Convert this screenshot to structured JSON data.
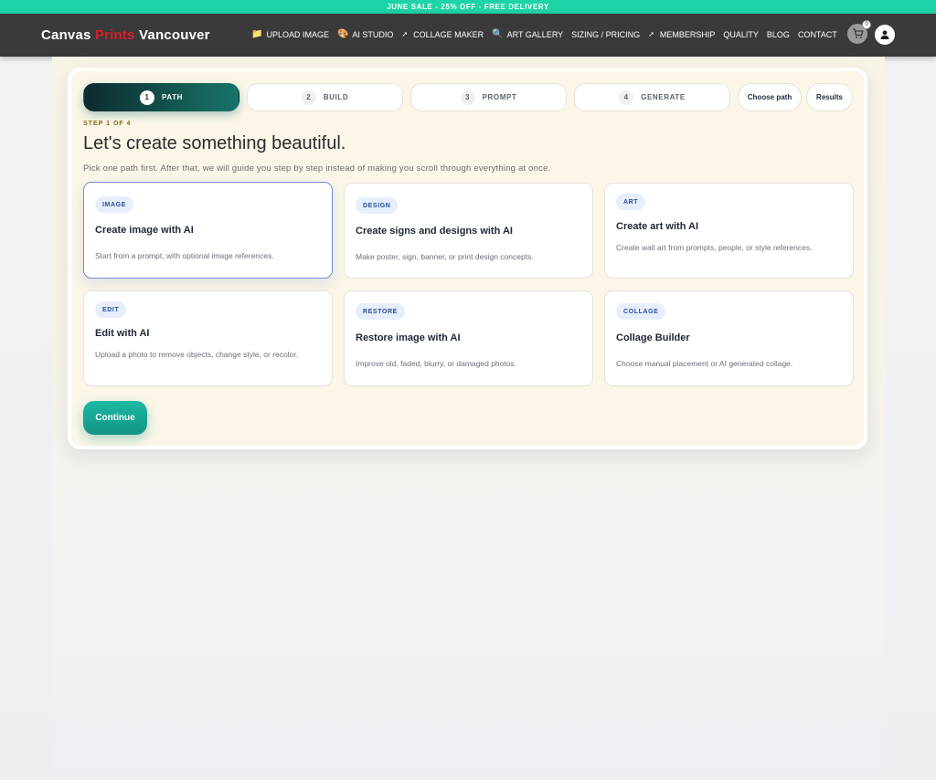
{
  "promo": {
    "text": "JUNE SALE - 25% OFF - FREE DELIVERY"
  },
  "header": {
    "logo": {
      "part1": "Canvas ",
      "part2": "Prints",
      "part3": " Vancouver"
    },
    "nav": [
      {
        "label": "UPLOAD IMAGE",
        "icon": "folder-icon"
      },
      {
        "label": "AI STUDIO",
        "icon": "palette-icon"
      },
      {
        "label": "COLLAGE MAKER",
        "icon": "arrow-icon"
      },
      {
        "label": "ART GALLERY",
        "icon": "magnifier-icon"
      },
      {
        "label": "SIZING / PRICING",
        "icon": ""
      },
      {
        "label": "MEMBERSHIP",
        "icon": "arrow-icon"
      },
      {
        "label": "QUALITY",
        "icon": ""
      },
      {
        "label": "BLOG",
        "icon": ""
      },
      {
        "label": "CONTACT",
        "icon": ""
      }
    ],
    "cart_count": "0"
  },
  "wizard": {
    "steps": [
      {
        "num": "1",
        "label": "PATH",
        "active": true
      },
      {
        "num": "2",
        "label": "BUILD",
        "active": false
      },
      {
        "num": "3",
        "label": "PROMPT",
        "active": false
      },
      {
        "num": "4",
        "label": "GENERATE",
        "active": false
      }
    ],
    "choose_path": "Choose path",
    "results": "Results",
    "step_label": "STEP 1 OF 4",
    "title": "Let's create something beautiful.",
    "subtitle": "Pick one path first. After that, we will guide you step by step instead of making you scroll through everything at once.",
    "cards": [
      {
        "badge": "IMAGE",
        "title": "Create image with AI",
        "desc": "Start from a prompt, with optional image references.",
        "selected": true
      },
      {
        "badge": "DESIGN",
        "title": "Create signs and designs with AI",
        "desc": "Make poster, sign, banner, or print design concepts.",
        "selected": false
      },
      {
        "badge": "ART",
        "title": "Create art with AI",
        "desc": "Create wall art from prompts, people, or style references.",
        "selected": false
      },
      {
        "badge": "EDIT",
        "title": "Edit with AI",
        "desc": "Upload a photo to remove objects, change style, or recolor.",
        "selected": false
      },
      {
        "badge": "RESTORE",
        "title": "Restore image with AI",
        "desc": "Improve old, faded, blurry, or damaged photos.",
        "selected": false
      },
      {
        "badge": "COLLAGE",
        "title": "Collage Builder",
        "desc": "Choose manual placement or AI generated collage.",
        "selected": false
      }
    ],
    "continue": "Continue"
  },
  "colors": {
    "promo_bar": "#1fd3a8",
    "header_bg": "#3a3a3a",
    "logo_accent": "#d61f26",
    "active_step_start": "#0d2b2e",
    "active_step_end": "#17746a",
    "continue_button": "#1db8a3",
    "selected_card_border": "#6e8fd4"
  }
}
